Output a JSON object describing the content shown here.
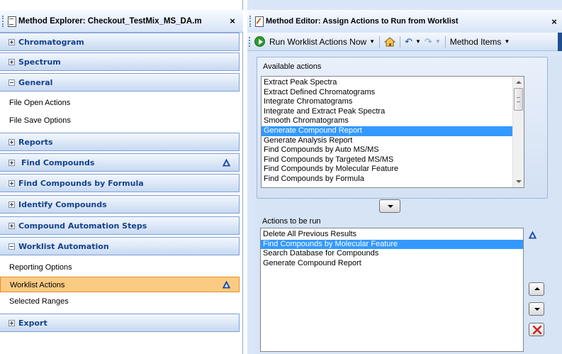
{
  "left_pane": {
    "title": "Method Explorer: Checkout_TestMix_MS_DA.m",
    "close": "×",
    "sections": [
      {
        "label": "Chromatogram",
        "expanded": false
      },
      {
        "label": "Spectrum",
        "expanded": false
      },
      {
        "label": "General",
        "expanded": true,
        "items": [
          "File Open Actions",
          "File Save Options"
        ]
      },
      {
        "label": "Reports",
        "expanded": false
      },
      {
        "label": "Find Compounds",
        "expanded": false,
        "has_indicator": true
      },
      {
        "label": "Find Compounds by Formula",
        "expanded": false
      },
      {
        "label": "Identify Compounds",
        "expanded": false
      },
      {
        "label": "Compound Automation Steps",
        "expanded": false
      },
      {
        "label": "Worklist Automation",
        "expanded": true,
        "items": [
          "Reporting Options",
          "Worklist Actions",
          "Selected Ranges"
        ],
        "selected_item": "Worklist Actions"
      },
      {
        "label": "Export",
        "expanded": false
      }
    ]
  },
  "right_pane": {
    "title": "Method Editor: Assign Actions to Run from Worklist",
    "close": "×",
    "toolbar": {
      "run_label": "Run Worklist Actions Now",
      "method_items_label": "Method Items",
      "undo_glyph": "↶",
      "redo_glyph": "↷"
    },
    "available": {
      "label": "Available actions",
      "items": [
        "Extract Peak Spectra",
        "Extract Defined Chromatograms",
        "Integrate Chromatograms",
        "Integrate and Extract Peak Spectra",
        "Smooth Chromatograms",
        "Generate Compound Report",
        "Generate Analysis Report",
        "Find Compounds by Auto MS/MS",
        "Find Compounds by Targeted MS/MS",
        "Find Compounds by Molecular Feature",
        "Find Compounds by Formula"
      ],
      "selected": "Generate Compound Report"
    },
    "to_run": {
      "label": "Actions to be run",
      "items": [
        "Delete All Previous Results",
        "Find Compounds by Molecular Feature",
        "Search Database for Compounds",
        "Generate Compound Report"
      ],
      "selected": "Find Compounds by Molecular Feature"
    }
  },
  "colors": {
    "section_text": "#15428b",
    "selected_item_bg": "#fbcb84",
    "list_selection": "#3399ff",
    "pane_bg": "#d9e6f7"
  }
}
